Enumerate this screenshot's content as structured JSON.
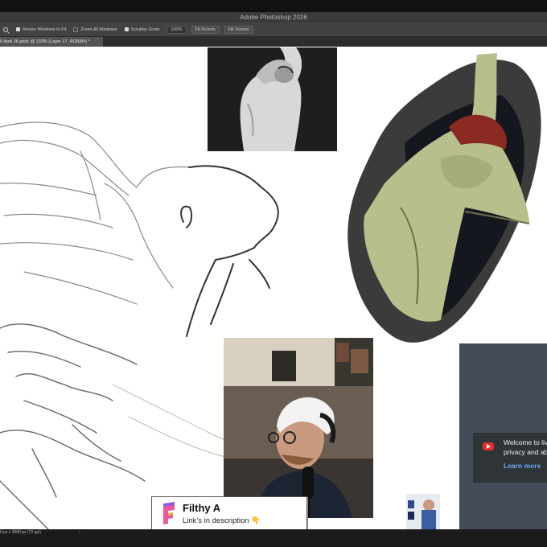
{
  "window": {
    "title": "Adobe Photoshop 2026"
  },
  "options_bar": {
    "tool_icon": "zoom-magnifier-icon",
    "resize_windows_label": "Resize Windows to Fit",
    "resize_windows_checked": true,
    "zoom_all_label": "Zoom All Windows",
    "zoom_all_checked": false,
    "scrubby_label": "Scrubby Zoom",
    "scrubby_checked": true,
    "zoom_value": "100%",
    "fit_screen": "Fit Screen",
    "fill_screen": "Fill Screen"
  },
  "document_tab": {
    "label": "0 April 26.psdc @ 133% (Layer 17, RGB/8#) *"
  },
  "status_bar": {
    "doc_size": "0 px x 3000 px (72 ppi)",
    "chevron": "›"
  },
  "overlay_banner": {
    "title": "Filthy A",
    "subtitle": "Link's in description",
    "emoji": "👇"
  },
  "notification": {
    "line1": "Welcome to liv",
    "line2": "privacy and ab",
    "link": "Learn more"
  },
  "colors": {
    "titlebar": "#111111",
    "options_bar": "#424242",
    "canvas": "#ffffff",
    "panel": "#434c58",
    "link_blue": "#6eaaf2",
    "youtube_red": "#e52d27"
  }
}
